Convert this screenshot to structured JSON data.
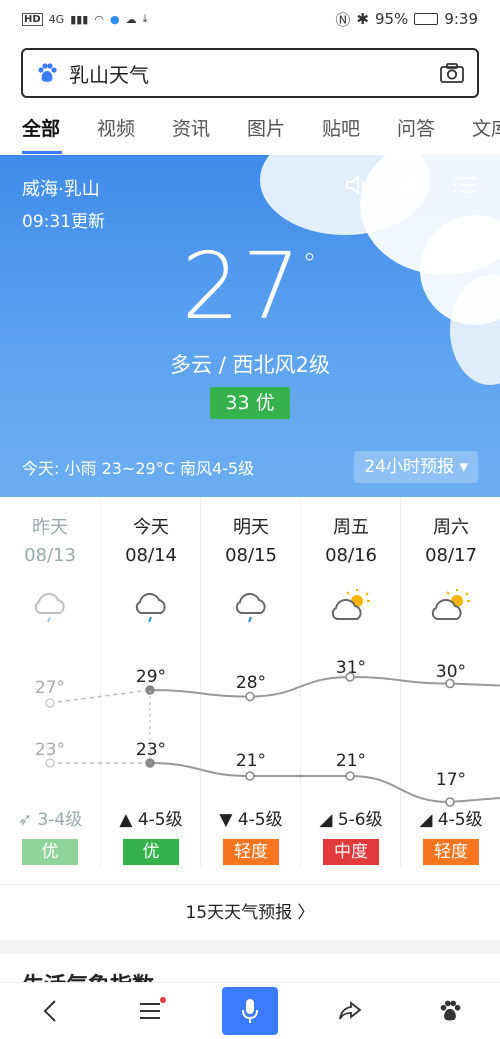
{
  "status": {
    "battery": "95%",
    "time": "9:39",
    "network": "4G"
  },
  "search": {
    "query": "乳山天气"
  },
  "tabs": [
    "全部",
    "视频",
    "资讯",
    "图片",
    "贴吧",
    "问答",
    "文库"
  ],
  "hero": {
    "location": "威海·乳山",
    "updated": "09:31更新",
    "temperature": "27",
    "degree": "°",
    "condition": "多云 / 西北风2级",
    "aqi": "33 优",
    "today_summary": "今天: 小雨  23~29°C  南风4-5级",
    "forecast_button": "24小时预报 ▾"
  },
  "days": [
    {
      "name": "昨天",
      "date": "08/13",
      "icon": "rain-cloud-icon",
      "high": "27°",
      "low": "23°",
      "wind": "3-4级",
      "air": "优",
      "air_color": "#35b24b",
      "past": true
    },
    {
      "name": "今天",
      "date": "08/14",
      "icon": "rain-cloud-icon",
      "high": "29°",
      "low": "23°",
      "wind": "4-5级",
      "air": "优",
      "air_color": "#35b24b",
      "past": false
    },
    {
      "name": "明天",
      "date": "08/15",
      "icon": "rain-cloud-icon",
      "high": "28°",
      "low": "21°",
      "wind": "4-5级",
      "air": "轻度",
      "air_color": "#f5761f",
      "past": false
    },
    {
      "name": "周五",
      "date": "08/16",
      "icon": "partly-sunny-icon",
      "high": "31°",
      "low": "21°",
      "wind": "5-6级",
      "air": "中度",
      "air_color": "#e23a3a",
      "past": false
    },
    {
      "name": "周六",
      "date": "08/17",
      "icon": "partly-sunny-icon",
      "high": "30°",
      "low": "17°",
      "wind": "4-5级",
      "air": "轻度",
      "air_color": "#f5761f",
      "past": false
    }
  ],
  "chart_data": {
    "type": "line",
    "categories": [
      "08/13",
      "08/14",
      "08/15",
      "08/16",
      "08/17"
    ],
    "series": [
      {
        "values": [
          27,
          29,
          28,
          31,
          30
        ]
      },
      {
        "values": [
          23,
          23,
          21,
          21,
          17
        ]
      }
    ]
  },
  "more_link": "15天天气预报 〉",
  "life_section_title": "生活气象指数"
}
